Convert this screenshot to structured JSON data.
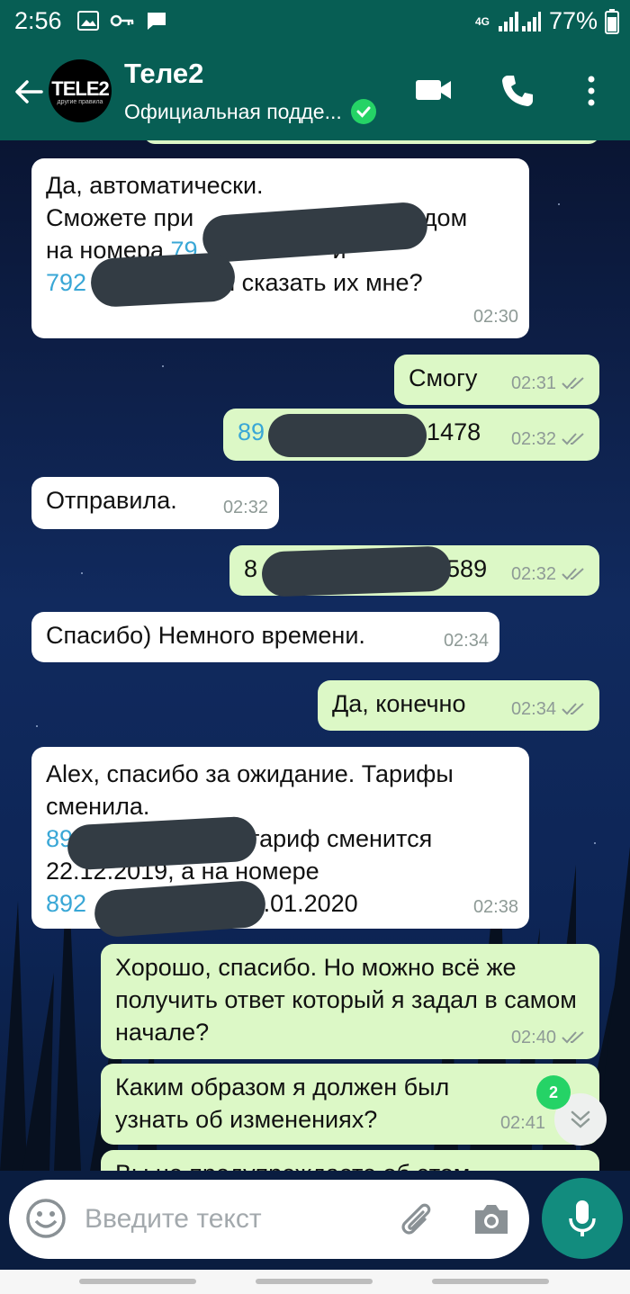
{
  "statusbar": {
    "time": "2:56",
    "network": "4G",
    "battery": "77%"
  },
  "header": {
    "title": "Теле2",
    "subtitle": "Официальная подде...",
    "avatar_logo": "TELE2",
    "avatar_tagline": "другие правила"
  },
  "messages": [
    {
      "dir": "in",
      "lines": [
        "Да, автоматически.",
        "Сможете при",
        "sms с кодом",
        "на номера",
        "79",
        "и",
        "792",
        "и сказать их мне?"
      ],
      "time": "02:30"
    },
    {
      "dir": "out",
      "text": "Смогу",
      "time": "02:31"
    },
    {
      "dir": "out",
      "prefix": "89",
      "suffix": "1478",
      "time": "02:32"
    },
    {
      "dir": "in",
      "text": "Отправила.",
      "time": "02:32"
    },
    {
      "dir": "out",
      "prefix": "8",
      "suffix": "589",
      "time": "02:32"
    },
    {
      "dir": "in",
      "text": "Спасибо) Немного времени.",
      "time": "02:34"
    },
    {
      "dir": "out",
      "text": "Да, конечно",
      "time": "02:34"
    },
    {
      "dir": "in",
      "lines": [
        "Alex, спасибо за ожидание. Тарифы",
        "сменила.",
        "89",
        "тариф сменится",
        "22.12.2019, а на номере",
        "892",
        "- 19.01.2020"
      ],
      "time": "02:38"
    },
    {
      "dir": "out",
      "text": "Хорошо, спасибо. Но можно всё же получить ответ который я задал в самом начале?",
      "time": "02:40"
    },
    {
      "dir": "out",
      "text": "Каким образом я должен был узнать об изменениях?",
      "time": "02:41"
    },
    {
      "dir": "out",
      "text": "Вы не предупреждаете об этом",
      "time": ""
    }
  ],
  "unread_count": "2",
  "composer": {
    "placeholder": "Введите текст"
  },
  "colors": {
    "header": "#075e54",
    "outgoing": "#dcf8c6",
    "incoming": "#ffffff",
    "accent": "#25d366",
    "link": "#39a7d6"
  },
  "icons": [
    "back-arrow-icon",
    "video-call-icon",
    "phone-icon",
    "more-options-icon",
    "verified-icon",
    "emoji-icon",
    "attach-icon",
    "camera-icon",
    "mic-icon",
    "double-check-icon",
    "scroll-down-icon"
  ]
}
